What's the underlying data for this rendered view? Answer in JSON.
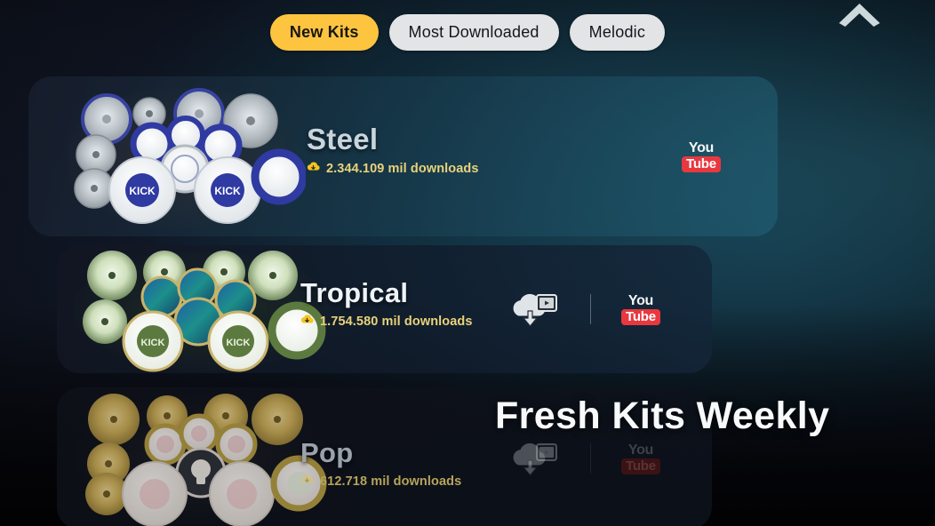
{
  "app": {
    "hero_text": "Fresh Kits Weekly"
  },
  "tabs": [
    {
      "label": "New Kits",
      "active": true
    },
    {
      "label": "Most Downloaded",
      "active": false
    },
    {
      "label": "Melodic",
      "active": false
    }
  ],
  "top_bar": {
    "collapse_icon": "chevron-up-icon"
  },
  "kits": [
    {
      "name": "Steel",
      "downloads": "2.344.109 mil downloads",
      "download_icon": "cloud-download-icon",
      "theme": "silver-blue",
      "actions": [
        "youtube-icon"
      ]
    },
    {
      "name": "Tropical",
      "downloads": "1.754.580 mil downloads",
      "download_icon": "cloud-download-icon",
      "theme": "green-palm",
      "actions": [
        "cloud-download-video-icon",
        "divider",
        "youtube-icon"
      ]
    },
    {
      "name": "Pop",
      "downloads": "612.718 mil downloads",
      "download_icon": "cloud-download-icon",
      "theme": "gold-floral",
      "actions": [
        "cloud-download-video-icon",
        "divider",
        "youtube-icon"
      ]
    }
  ],
  "youtube": {
    "you": "You",
    "tube": "Tube"
  },
  "colors": {
    "accent_yellow": "#fdc440",
    "downloads_text": "#e9d27a",
    "youtube_red": "#e8383f",
    "tab_inactive": "#e2e4e6"
  }
}
